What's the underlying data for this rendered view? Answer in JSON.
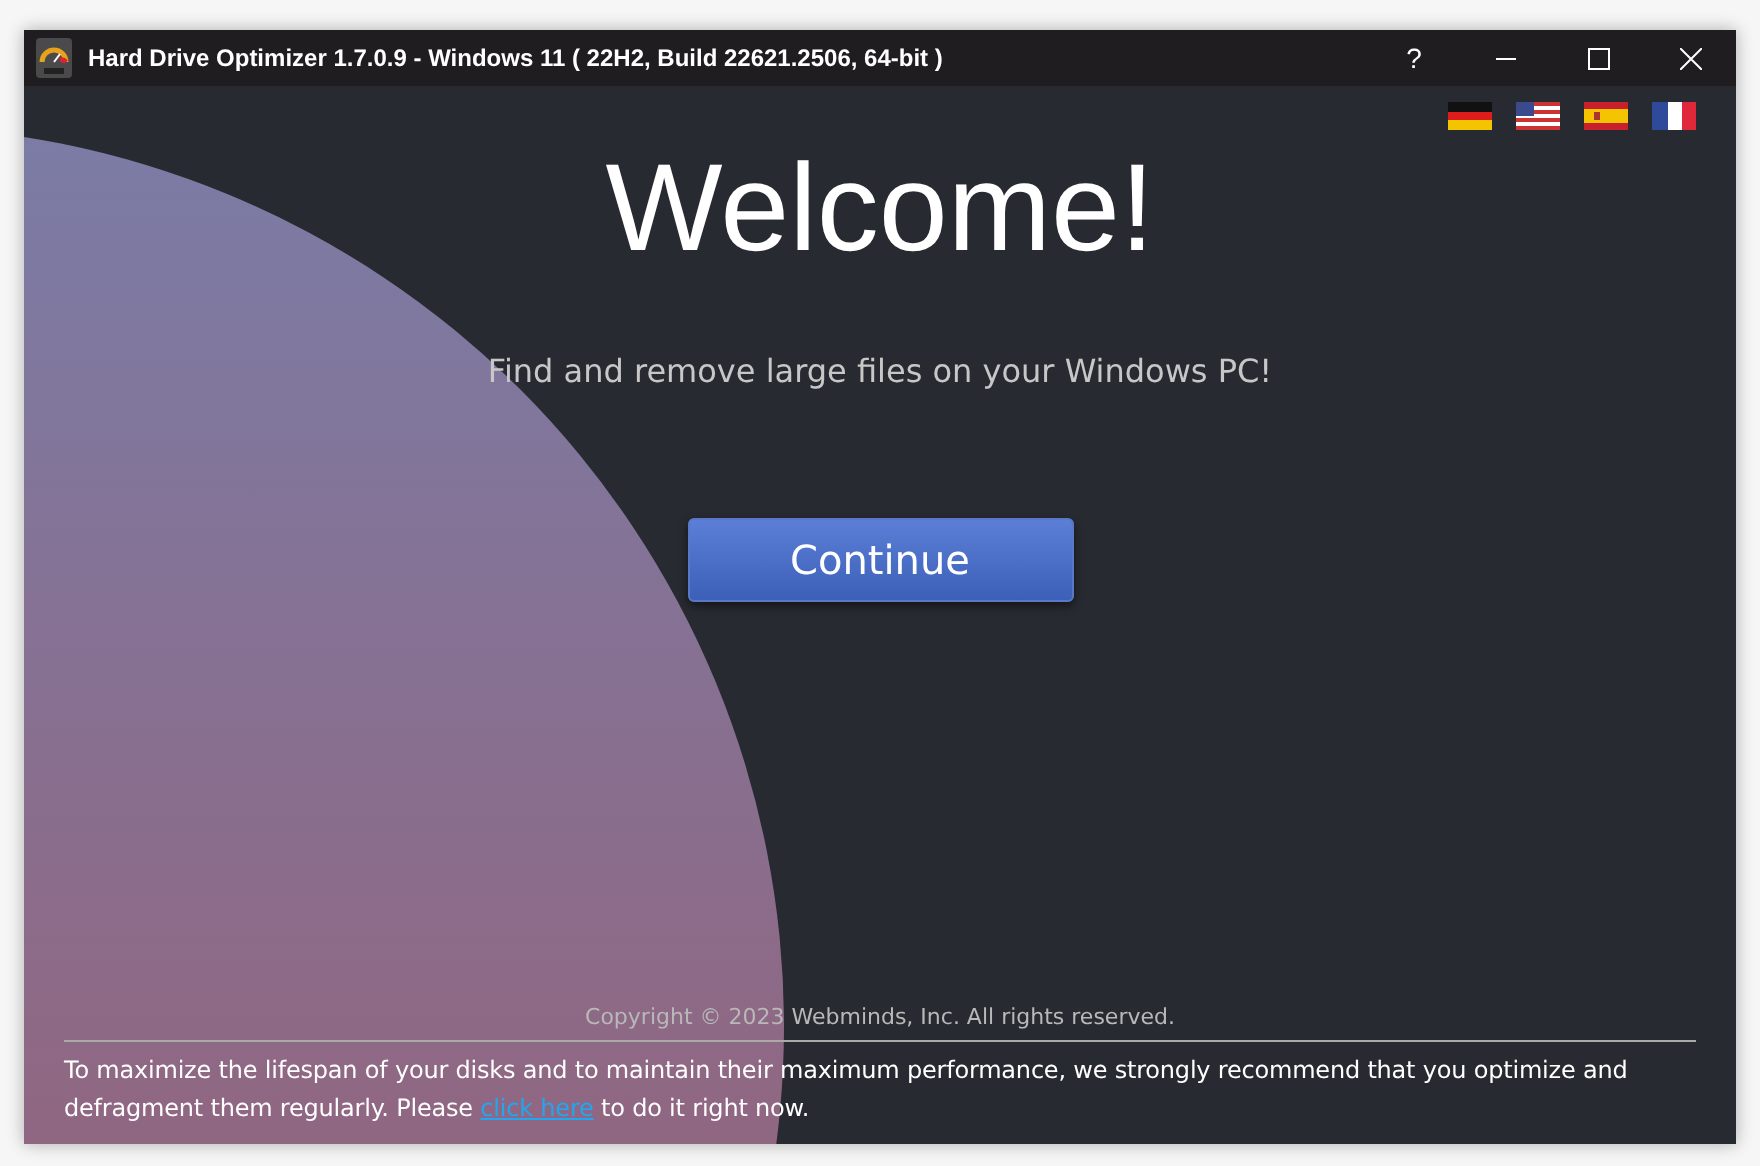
{
  "window": {
    "title": "Hard Drive Optimizer 1.7.0.9 - Windows 11 ( 22H2, Build 22621.2506, 64-bit )",
    "help": "?"
  },
  "languages": [
    {
      "kind": "de"
    },
    {
      "kind": "us"
    },
    {
      "kind": "es"
    },
    {
      "kind": "fr"
    }
  ],
  "heading": "Welcome!",
  "subtitle": "Find and remove large files on your Windows PC!",
  "continue_button": "Continue",
  "copyright": "Copyright © 2023 Webminds, Inc. All rights reserved.",
  "notice": {
    "before": "To maximize the lifespan of your disks and to maintain their maximum performance, we strongly recommend that you optimize and defragment them regularly. Please ",
    "link": "click here",
    "after": " to do it right now."
  }
}
